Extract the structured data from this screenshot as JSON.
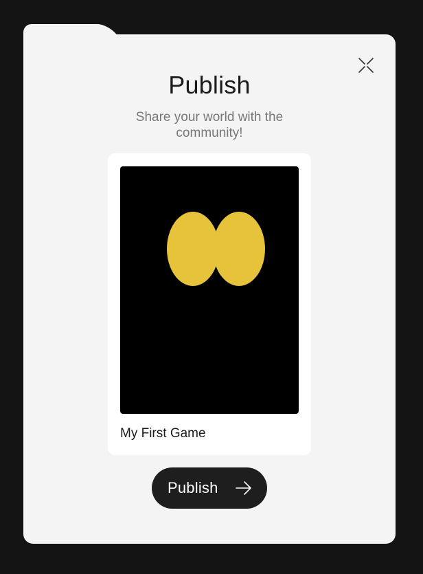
{
  "dialog": {
    "title": "Publish",
    "subtitle": "Share your world with the community!",
    "close_icon": "close-icon"
  },
  "game_card": {
    "name": "My First Game",
    "thumbnail": {
      "background_color": "#000000",
      "shape_color": "#e6c33a"
    }
  },
  "actions": {
    "publish_label": "Publish",
    "publish_icon": "arrow-right-icon"
  },
  "colors": {
    "backdrop": "#141414",
    "panel": "#f4f4f4",
    "button": "#1e1e1e"
  }
}
